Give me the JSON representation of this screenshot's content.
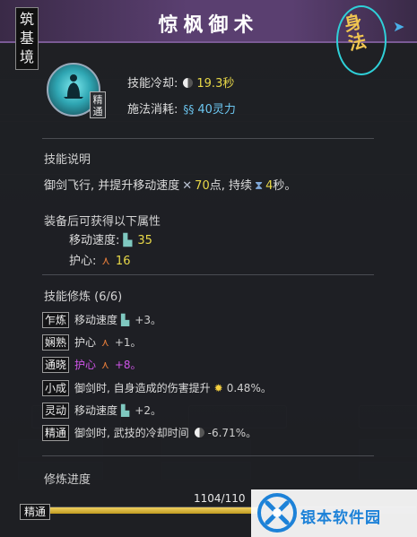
{
  "realm": "筑基境",
  "skill": {
    "name": "惊枫御术",
    "category": "身法",
    "icon": "meditation-figure-icon",
    "mastery": "精通",
    "cooldown_label": "技能冷却:",
    "cooldown_value": "19.3秒",
    "cost_label": "施法消耗:",
    "cost_value": "40灵力"
  },
  "description": {
    "title": "技能说明",
    "prefix": "御剑飞行, 并提升移动速度",
    "speed_value": "70",
    "speed_unit": "点, 持续",
    "duration_value": "4",
    "duration_unit": "秒。"
  },
  "equip": {
    "title": "装备后可获得以下属性",
    "attributes": [
      {
        "label": "移动速度:",
        "icon": "boot-icon",
        "value": "35"
      },
      {
        "label": "护心:",
        "icon": "triad-icon",
        "value": "16"
      }
    ]
  },
  "training": {
    "title": "技能修炼 (6/6)",
    "rows": [
      {
        "tier": "乍炼",
        "text": "移动速度",
        "icon": "boot-icon",
        "value": "+3。"
      },
      {
        "tier": "娴熟",
        "text": "护心",
        "icon": "triad-icon",
        "value": "+1。"
      },
      {
        "tier": "通晓",
        "text": "护心",
        "icon": "triad-icon",
        "value": "+8。",
        "highlight": "#cf55e8"
      },
      {
        "tier": "小成",
        "text": "御剑时, 自身造成的伤害提升",
        "icon": "sun-icon",
        "value": "0.48%。"
      },
      {
        "tier": "灵动",
        "text": "移动速度",
        "icon": "boot-icon",
        "value": "+2。"
      },
      {
        "tier": "精通",
        "text": "御剑时, 武技的冷却时间",
        "icon": "moon-icon",
        "value": "-6.71%。"
      }
    ]
  },
  "progress": {
    "title": "修炼进度",
    "tier": "精通",
    "text": "1104/110",
    "fraction": 0.6
  },
  "watermark": "银本软件园",
  "colors": {
    "title_bar": "#5a3f70",
    "highlight_value": "#e8d848",
    "purple_text": "#cf55e8",
    "badge_ring": "#2fd0d8"
  }
}
